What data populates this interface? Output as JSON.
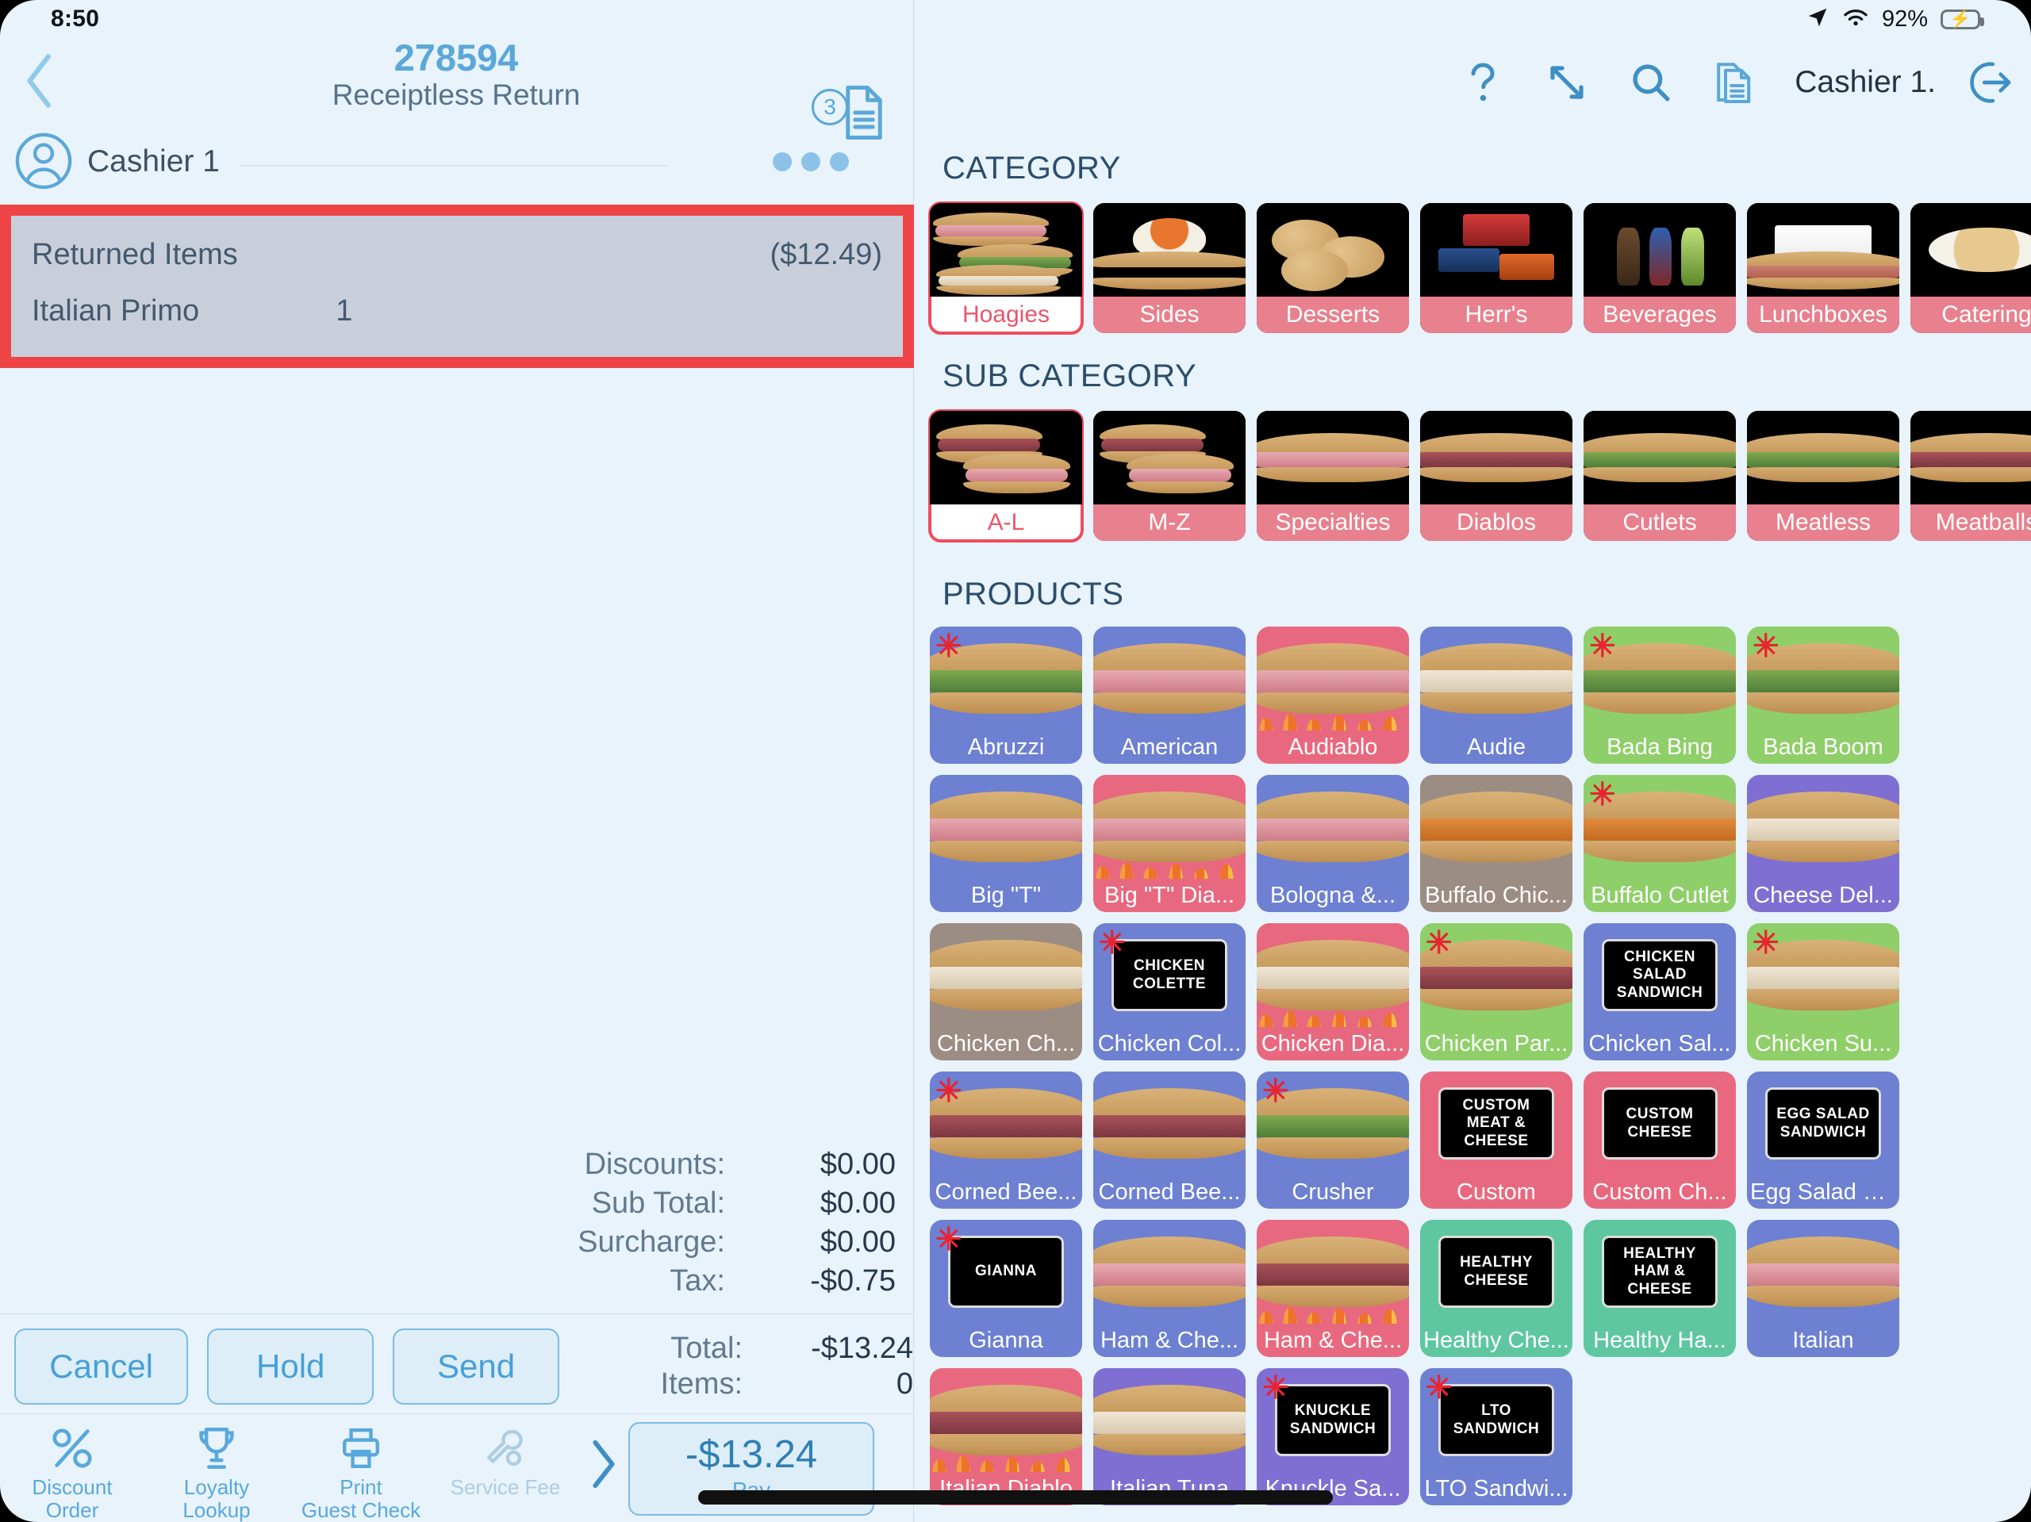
{
  "status_bar": {
    "time": "8:50",
    "battery_percent": "92%",
    "icons": [
      "location-arrow-icon",
      "wifi-icon",
      "battery-charging-icon"
    ]
  },
  "header": {
    "back_icon": "chevron-left-icon",
    "order_number": "278594",
    "order_type": "Receiptless Return",
    "document_badge_count": "3",
    "document_icon": "document-icon",
    "right_icons": [
      "help-icon",
      "resize-icon",
      "search-icon",
      "documents-icon"
    ],
    "cashier_label": "Cashier 1.",
    "logout_icon": "logout-icon"
  },
  "order_panel": {
    "avatar_icon": "user-avatar-icon",
    "cashier": "Cashier 1",
    "more_icon": "more-dots-icon",
    "returned": {
      "header_label": "Returned Items",
      "header_amount": "($12.49)",
      "item_name": "Italian Primo",
      "item_qty": "1"
    }
  },
  "totals": {
    "rows": [
      {
        "label": "Discounts:",
        "value": "$0.00"
      },
      {
        "label": "Sub Total:",
        "value": "$0.00"
      },
      {
        "label": "Surcharge:",
        "value": "$0.00"
      },
      {
        "label": "Tax:",
        "value": "-$0.75"
      }
    ],
    "total_label": "Total:",
    "total_value": "-$13.24",
    "items_label": "Items:",
    "items_value": "0"
  },
  "actions": {
    "cancel": "Cancel",
    "hold": "Hold",
    "send": "Send"
  },
  "toolbar": {
    "tools": [
      {
        "icon": "percent-icon",
        "line1": "Discount",
        "line2": "Order",
        "disabled": false
      },
      {
        "icon": "trophy-icon",
        "line1": "Loyalty",
        "line2": "Lookup",
        "disabled": false
      },
      {
        "icon": "printer-icon",
        "line1": "Print",
        "line2": "Guest Check",
        "disabled": false
      },
      {
        "icon": "wrench-icon",
        "line1": "Service Fee",
        "line2": "",
        "disabled": true
      }
    ],
    "chevron_icon": "chevron-right-icon",
    "pay_amount": "-$13.24",
    "pay_label": "Pay"
  },
  "catalog": {
    "category_title": "CATEGORY",
    "subcategory_title": "SUB CATEGORY",
    "products_title": "PRODUCTS",
    "categories": [
      {
        "label": "Hoagies",
        "selected": true,
        "art": "hoagie-stack"
      },
      {
        "label": "Sides",
        "selected": false,
        "art": "salad-bowl"
      },
      {
        "label": "Desserts",
        "selected": false,
        "art": "cookies"
      },
      {
        "label": "Herr's",
        "selected": false,
        "art": "snack-packs"
      },
      {
        "label": "Beverages",
        "selected": false,
        "art": "bottles"
      },
      {
        "label": "Lunchboxes",
        "selected": false,
        "art": "lunchbox"
      },
      {
        "label": "Catering",
        "selected": false,
        "art": "platter"
      }
    ],
    "subcategories": [
      {
        "label": "A-L",
        "selected": true,
        "art": "sub-pair"
      },
      {
        "label": "M-Z",
        "selected": false,
        "art": "sub-pair"
      },
      {
        "label": "Specialties",
        "selected": false,
        "art": "sub-ham"
      },
      {
        "label": "Diablos",
        "selected": false,
        "art": "sub-beef"
      },
      {
        "label": "Cutlets",
        "selected": false,
        "art": "sub-veg"
      },
      {
        "label": "Meatless",
        "selected": false,
        "art": "sub-veg2"
      },
      {
        "label": "Meatballs",
        "selected": false,
        "art": "sub-beef2"
      }
    ],
    "products": [
      {
        "label": "Abruzzi",
        "color": "#6d80d2",
        "star": true,
        "art": "sw veg",
        "sign": null
      },
      {
        "label": "American",
        "color": "#6d80d2",
        "star": false,
        "art": "sw ham",
        "sign": null
      },
      {
        "label": "Audiablo",
        "color": "#e8697f",
        "star": false,
        "art": "sw ham flame",
        "sign": null
      },
      {
        "label": "Audie",
        "color": "#6d80d2",
        "star": false,
        "art": "sw white",
        "sign": null
      },
      {
        "label": "Bada Bing",
        "color": "#8fcf6a",
        "star": true,
        "art": "sw veg",
        "sign": null
      },
      {
        "label": "Bada Boom",
        "color": "#8fcf6a",
        "star": true,
        "art": "sw veg",
        "sign": null
      },
      {
        "label": "Big \"T\"",
        "color": "#6d80d2",
        "star": false,
        "art": "sw ham",
        "sign": null
      },
      {
        "label": "Big \"T\" Dia...",
        "color": "#e8697f",
        "star": false,
        "art": "sw ham flame",
        "sign": null
      },
      {
        "label": "Bologna &...",
        "color": "#6d80d2",
        "star": false,
        "art": "sw ham",
        "sign": null
      },
      {
        "label": "Buffalo Chic...",
        "color": "#9c8d84",
        "star": false,
        "art": "sw buf",
        "sign": null
      },
      {
        "label": "Buffalo Cutlet",
        "color": "#8fcf6a",
        "star": true,
        "art": "sw buf",
        "sign": null
      },
      {
        "label": "Cheese Del...",
        "color": "#7f6fd2",
        "star": false,
        "art": "sw white",
        "sign": null
      },
      {
        "label": "Chicken Ch...",
        "color": "#9c8d84",
        "star": false,
        "art": "sw white",
        "sign": null
      },
      {
        "label": "Chicken Col...",
        "color": "#6d80d2",
        "star": true,
        "art": null,
        "sign": [
          "CHICKEN",
          "COLETTE"
        ]
      },
      {
        "label": "Chicken Dia...",
        "color": "#e8697f",
        "star": false,
        "art": "sw white flame",
        "sign": null
      },
      {
        "label": "Chicken Par...",
        "color": "#8fcf6a",
        "star": true,
        "art": "sw beef",
        "sign": null
      },
      {
        "label": "Chicken Sal...",
        "color": "#6d80d2",
        "star": false,
        "art": null,
        "sign": [
          "CHICKEN",
          "SALAD",
          "SANDWICH"
        ]
      },
      {
        "label": "Chicken Su...",
        "color": "#8fcf6a",
        "star": true,
        "art": "sw white",
        "sign": null
      },
      {
        "label": "Corned Bee...",
        "color": "#6d80d2",
        "star": true,
        "art": "sw beef",
        "sign": null
      },
      {
        "label": "Corned Bee...",
        "color": "#6d80d2",
        "star": false,
        "art": "sw beef",
        "sign": null
      },
      {
        "label": "Crusher",
        "color": "#6d80d2",
        "star": true,
        "art": "sw veg",
        "sign": null
      },
      {
        "label": "Custom",
        "color": "#e8697f",
        "star": false,
        "art": null,
        "sign": [
          "CUSTOM",
          "MEAT &",
          "CHEESE"
        ]
      },
      {
        "label": "Custom Ch...",
        "color": "#e8697f",
        "star": false,
        "art": null,
        "sign": [
          "CUSTOM",
          "CHEESE"
        ]
      },
      {
        "label": "Egg Salad S...",
        "color": "#6d80d2",
        "star": false,
        "art": null,
        "sign": [
          "EGG SALAD",
          "SANDWICH"
        ]
      },
      {
        "label": "Gianna",
        "color": "#6d80d2",
        "star": true,
        "art": null,
        "sign": [
          "GIANNA"
        ]
      },
      {
        "label": "Ham & Che...",
        "color": "#6d80d2",
        "star": false,
        "art": "sw ham",
        "sign": null
      },
      {
        "label": "Ham & Che...",
        "color": "#e8697f",
        "star": false,
        "art": "sw beef flame",
        "sign": null
      },
      {
        "label": "Healthy Che...",
        "color": "#5fc7a0",
        "star": false,
        "art": null,
        "sign": [
          "HEALTHY",
          "CHEESE"
        ]
      },
      {
        "label": "Healthy Ha...",
        "color": "#5fc7a0",
        "star": false,
        "art": null,
        "sign": [
          "HEALTHY",
          "HAM &",
          "CHEESE"
        ]
      },
      {
        "label": "Italian",
        "color": "#6d80d2",
        "star": false,
        "art": "sw ham",
        "sign": null
      },
      {
        "label": "Italian Diablo",
        "color": "#e8697f",
        "star": false,
        "art": "sw beef flame",
        "sign": null
      },
      {
        "label": "Italian Tuna",
        "color": "#7f6fd2",
        "star": false,
        "art": "sw white",
        "sign": null
      },
      {
        "label": "Knuckle Sa...",
        "color": "#7f6fd2",
        "star": true,
        "art": null,
        "sign": [
          "KNUCKLE",
          "SANDWICH"
        ]
      },
      {
        "label": "LTO Sandwi...",
        "color": "#6d80d2",
        "star": true,
        "art": null,
        "sign": [
          "LTO",
          "SANDWICH"
        ]
      }
    ]
  }
}
